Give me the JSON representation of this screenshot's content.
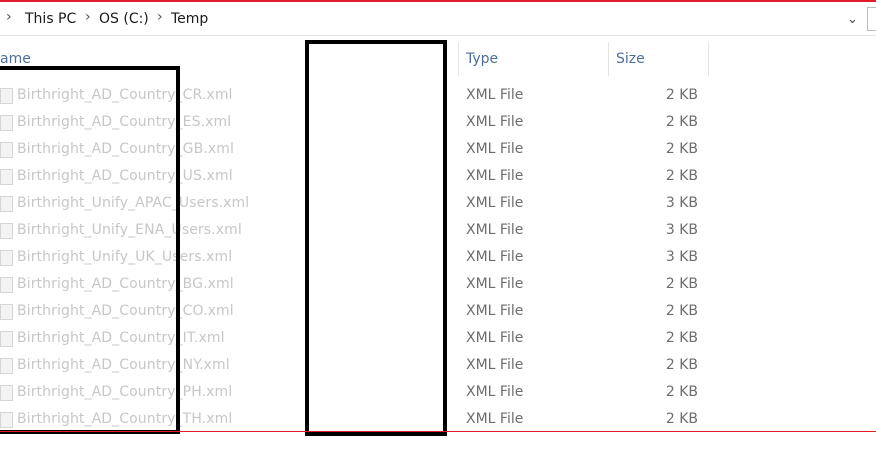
{
  "breadcrumb": {
    "items": [
      "This PC",
      "OS (C:)",
      "Temp"
    ],
    "separator": ">"
  },
  "columns": {
    "name": "ame",
    "type": "Type",
    "size": "Size"
  },
  "files": [
    {
      "name": "Birthright_AD_Country_CR.xml",
      "type": "XML File",
      "size": "2 KB"
    },
    {
      "name": "Birthright_AD_Country_ES.xml",
      "type": "XML File",
      "size": "2 KB"
    },
    {
      "name": "Birthright_AD_Country_GB.xml",
      "type": "XML File",
      "size": "2 KB"
    },
    {
      "name": "Birthright_AD_Country_US.xml",
      "type": "XML File",
      "size": "2 KB"
    },
    {
      "name": "Birthright_Unify_APAC_Users.xml",
      "type": "XML File",
      "size": "3 KB"
    },
    {
      "name": "Birthright_Unify_ENA_Users.xml",
      "type": "XML File",
      "size": "3 KB"
    },
    {
      "name": "Birthright_Unify_UK_Users.xml",
      "type": "XML File",
      "size": "3 KB"
    },
    {
      "name": "Birthright_AD_Country_BG.xml",
      "type": "XML File",
      "size": "2 KB"
    },
    {
      "name": "Birthright_AD_Country_CO.xml",
      "type": "XML File",
      "size": "2 KB"
    },
    {
      "name": "Birthright_AD_Country_IT.xml",
      "type": "XML File",
      "size": "2 KB"
    },
    {
      "name": "Birthright_AD_Country_NY.xml",
      "type": "XML File",
      "size": "2 KB"
    },
    {
      "name": "Birthright_AD_Country_PH.xml",
      "type": "XML File",
      "size": "2 KB"
    },
    {
      "name": "Birthright_AD_Country_TH.xml",
      "type": "XML File",
      "size": "2 KB"
    }
  ],
  "icons": {
    "breadcrumb_separator": "chevron-right-icon",
    "address_dropdown": "chevron-down-icon",
    "file": "xml-file-icon"
  },
  "colors": {
    "accent_line": "#e11d2b",
    "column_header": "#4c6f9a",
    "redaction": "#000000"
  }
}
